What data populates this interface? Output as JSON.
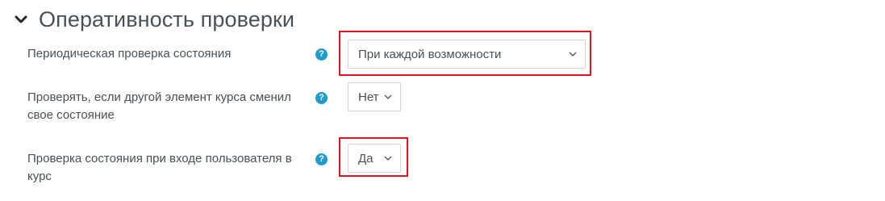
{
  "section": {
    "title": "Оперативность проверки",
    "toggle_icon": "chevron-down-icon"
  },
  "rows": [
    {
      "label": "Периодическая проверка состояния",
      "help_icon": "question-circle-icon",
      "help_glyph": "?",
      "select_value": "При каждой возможности",
      "highlighted": true
    },
    {
      "label": "Проверять, если другой элемент курса сменил свое состояние",
      "help_icon": "question-circle-icon",
      "help_glyph": "?",
      "select_value": "Нет",
      "highlighted": false
    },
    {
      "label": "Проверка состояния при входе пользователя в курс",
      "help_icon": "question-circle-icon",
      "help_glyph": "?",
      "select_value": "Да",
      "highlighted": true
    }
  ],
  "colors": {
    "help_icon": "#1f9bcf",
    "highlight_border": "#e8121c",
    "text": "#495057",
    "select_border": "#ced4da"
  }
}
